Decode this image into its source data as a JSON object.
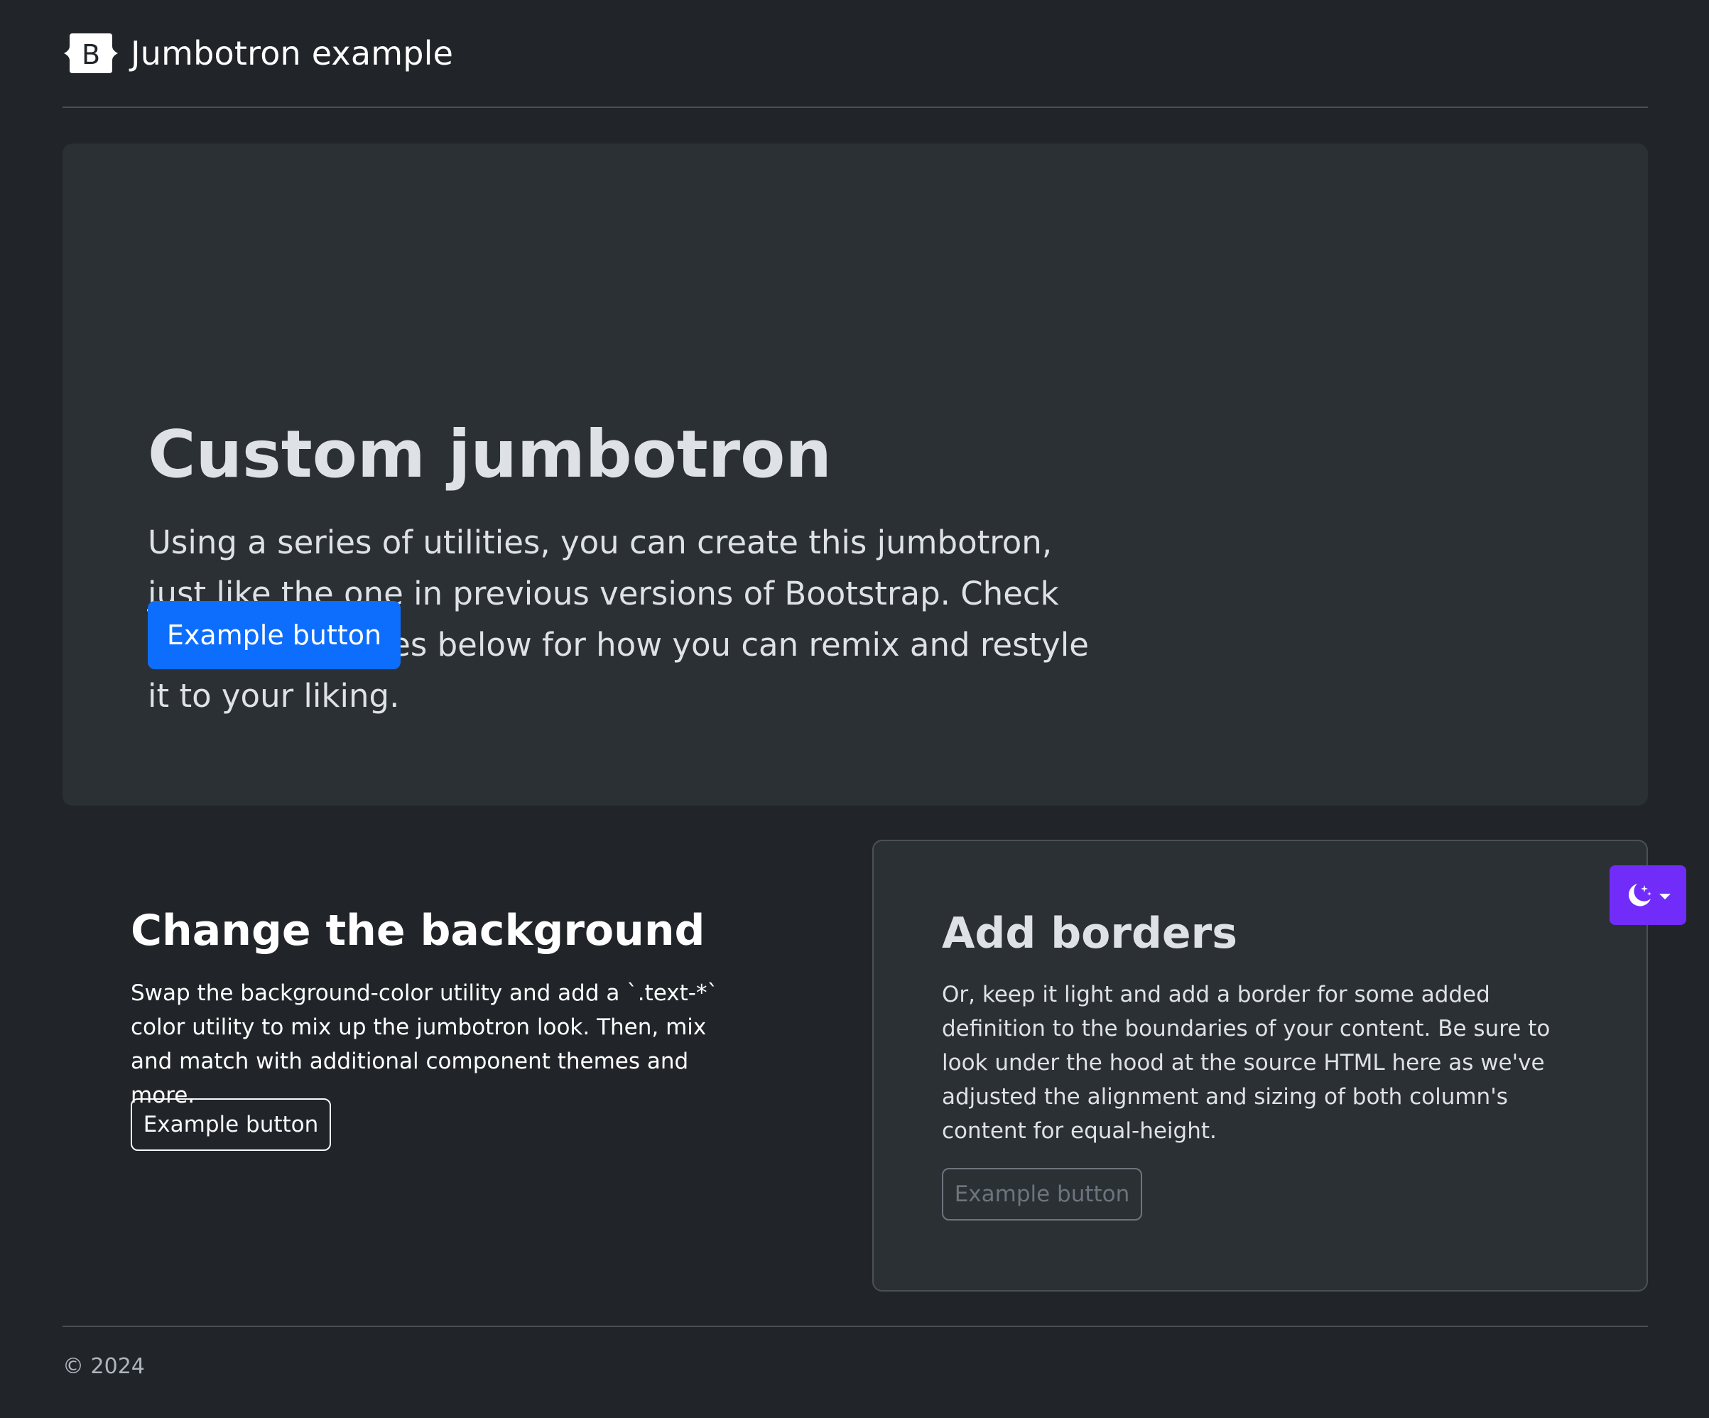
{
  "header": {
    "logo_letter": "B",
    "title": "Jumbotron example"
  },
  "jumbotron": {
    "title": "Custom jumbotron",
    "lead": "Using a series of utilities, you can create this jumbotron, just like the one in previous versions of Bootstrap. Check out the examples below for how you can remix and restyle it to your liking.",
    "button_label": "Example button"
  },
  "columns": {
    "left": {
      "title": "Change the background",
      "text": "Swap the background-color utility and add a `.text-*` color utility to mix up the jumbotron look. Then, mix and match with additional component themes and more.",
      "button_label": "Example button"
    },
    "right": {
      "title": "Add borders",
      "text": "Or, keep it light and add a border for some added definition to the boundaries of your content. Be sure to look under the hood at the source HTML here as we've adjusted the alignment and sizing of both column's content for equal-height.",
      "button_label": "Example button"
    }
  },
  "theme_toggle": {
    "icon": "moon-stars-icon",
    "caret_icon": "caret-down-icon"
  },
  "footer": {
    "text": "© 2024"
  },
  "colors": {
    "page_bg": "#212529",
    "card_bg": "#2b3035",
    "primary": "#0d6efd",
    "theme_toggle_bg": "#712cf9",
    "border": "#495057",
    "muted": "#6c757d"
  }
}
